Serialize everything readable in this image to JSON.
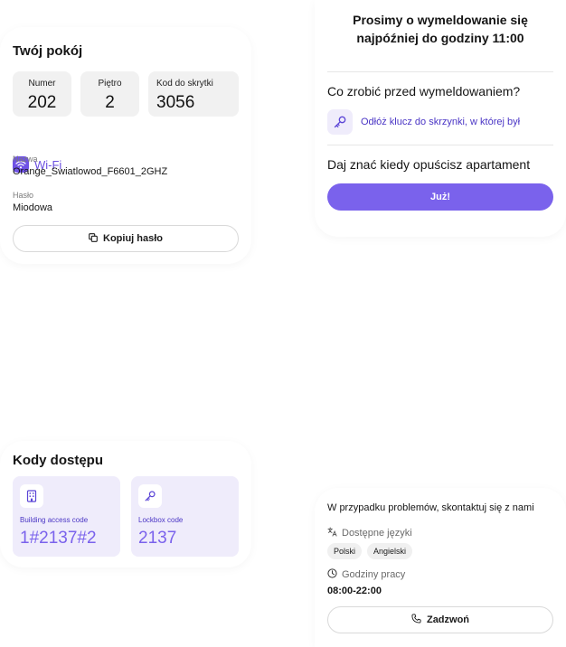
{
  "room": {
    "title": "Twój pokój",
    "number_label": "Numer",
    "number_value": "202",
    "floor_label": "Piętro",
    "floor_value": "2",
    "lockbox_label": "Kod do skrytki",
    "lockbox_value": "3056",
    "wifi_label": "Wi-Fi",
    "network_name_label": "Nazwa",
    "network_name": "Orange_Swiatlowod_F6601_2GHZ",
    "password_label": "Hasło",
    "password": "Miodowa",
    "copy_button": "Kopiuj hasło"
  },
  "checkout": {
    "title_line1": "Prosimy o wymeldowanie się",
    "title_line2": "najpóźniej do godziny 11:00",
    "before_heading": "Co zrobić przed wymeldowaniem?",
    "task": "Odłóż klucz do skrzynki, w której był",
    "notify_heading": "Daj znać kiedy opuścisz apartament",
    "done_button": "Już!"
  },
  "codes": {
    "title": "Kody dostępu",
    "items": [
      {
        "label": "Building access code",
        "value": "1#2137#2",
        "icon": "building-icon"
      },
      {
        "label": "Lockbox code",
        "value": "2137",
        "icon": "key-icon"
      }
    ]
  },
  "contact": {
    "title": "W przypadku problemów, skontaktuj się z nami",
    "languages_label": "Dostępne języki",
    "languages": [
      "Polski",
      "Angielski"
    ],
    "hours_label": "Godziny pracy",
    "hours": "08:00-22:00",
    "call_button": "Zadzwoń"
  },
  "colors": {
    "accent": "#7a62ec",
    "accent_dark": "#4a35c5",
    "tile_gray": "#f1f1f1",
    "tile_lavender": "#efecfb"
  }
}
